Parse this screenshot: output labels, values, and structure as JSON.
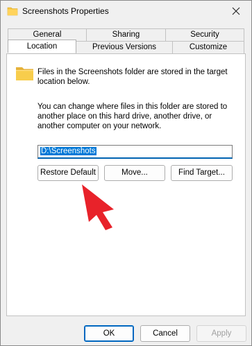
{
  "window": {
    "title": "Screenshots Properties"
  },
  "tabs": {
    "back_row": [
      "General",
      "Sharing",
      "Security"
    ],
    "front_row": [
      "Location",
      "Previous Versions",
      "Customize"
    ],
    "active": "Location"
  },
  "location": {
    "intro": "Files in the Screenshots folder are stored in the target location below.",
    "description": "You can change where files in this folder are stored to another place on this hard drive, another drive, or another computer on your network.",
    "path_value": "D:\\Screenshots",
    "restore_default_label": "Restore Default",
    "move_label": "Move...",
    "find_target_label": "Find Target..."
  },
  "footer": {
    "ok_label": "OK",
    "cancel_label": "Cancel",
    "apply_label": "Apply"
  },
  "colors": {
    "accent": "#0078d7",
    "folder": "#f5c542",
    "annotation_arrow": "#e8222a"
  },
  "icons": {
    "title": "folder-icon",
    "location": "folder-icon",
    "close": "close-icon",
    "annotation": "red-arrow-annotation"
  }
}
